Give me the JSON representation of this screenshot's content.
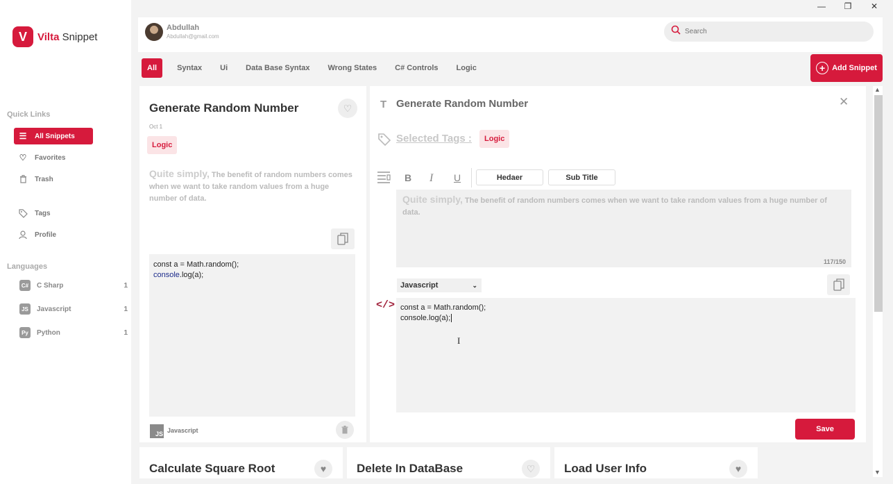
{
  "window": {
    "minimize": "—",
    "maximize": "❐",
    "close": "✕"
  },
  "brand": {
    "mark": "V",
    "name_bold": "Vilta",
    "name_rest": " Snippet"
  },
  "sidebar": {
    "quick_links_title": "Quick Links",
    "items": [
      {
        "label": "All Snippets",
        "icon": "list-icon",
        "glyph": "☰"
      },
      {
        "label": "Favorites",
        "icon": "heart-icon",
        "glyph": "♡"
      },
      {
        "label": "Trash",
        "icon": "trash-icon",
        "glyph": "🗑"
      },
      {
        "label": "Tags",
        "icon": "tag-icon",
        "glyph": "⌂"
      },
      {
        "label": "Profile",
        "icon": "user-icon",
        "glyph": "⚇"
      }
    ],
    "languages_title": "Languages",
    "languages": [
      {
        "label": "C Sharp",
        "count": "1",
        "glyph": "C#"
      },
      {
        "label": "Javascript",
        "count": "1",
        "glyph": "JS"
      },
      {
        "label": "Python",
        "count": "1",
        "glyph": "Py"
      }
    ]
  },
  "user": {
    "name": "Abdullah",
    "email": "Abdullah@gmail.com"
  },
  "search": {
    "placeholder": "Search"
  },
  "tabs": [
    "All",
    "Syntax",
    "Ui",
    "Data Base Syntax",
    "Wrong States",
    "C# Controls",
    "Logic"
  ],
  "add_snippet_label": "Add Snippet",
  "snippet_card": {
    "title": "Generate Random Number",
    "date": "Oct 1",
    "tag": "Logic",
    "desc_lead": "Quite simply,",
    "desc_rest": " The benefit of random numbers comes when we want to take random values from a huge number of data.",
    "code_line1": "const a = Math.random();",
    "code_line2_kw": "console",
    "code_line2_rest": ".log(a);",
    "language": "Javascript"
  },
  "editor": {
    "title": "Generate Random Number",
    "selected_tags_label": "Selected Tags :",
    "tag": "Logic",
    "format_bold": "B",
    "format_italic": "I",
    "format_underline": "U",
    "header_btn": "Hedaer",
    "subtitle_btn": "Sub Title",
    "desc_lead": "Quite simply,",
    "desc_rest": " The benefit of random numbers comes when we want to take random values      from a huge number of data.",
    "char_count": "117/150",
    "language": "Javascript",
    "code_line1": "const a = Math.random();",
    "code_line2": "console.log(a);",
    "save_label": "Save"
  },
  "bottom_cards": [
    {
      "title": "Calculate Square Root"
    },
    {
      "title": "Delete In DataBase"
    },
    {
      "title": "Load User Info"
    }
  ],
  "colors": {
    "accent": "#d61a3c",
    "tag_bg": "#fbe4e6"
  }
}
